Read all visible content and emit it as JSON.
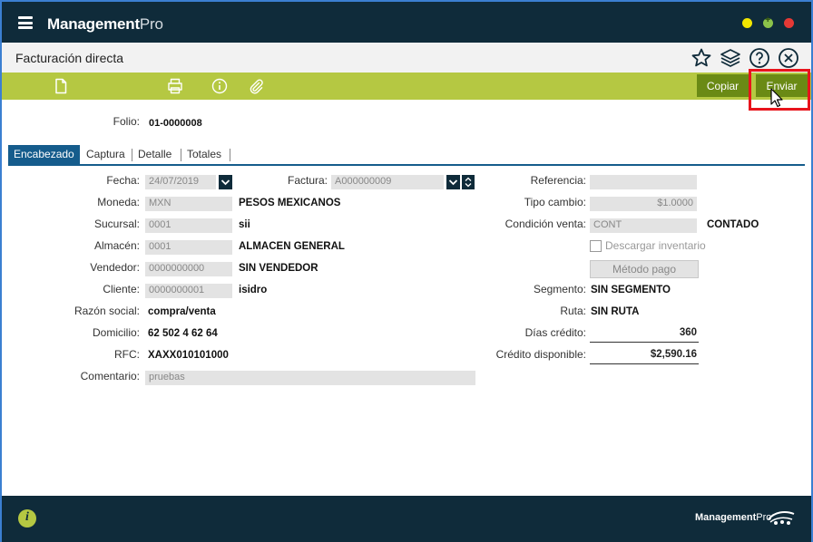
{
  "app": {
    "title_main": "Management",
    "title_suffix": "Pro"
  },
  "header": {
    "title": "Facturación directa"
  },
  "toolbar": {
    "copy_label": "Copiar",
    "send_label": "Enviar"
  },
  "folio": {
    "label": "Folio:",
    "value": "01-0000008"
  },
  "tabs": [
    {
      "label": "Encabezado",
      "active": true
    },
    {
      "label": "Captura",
      "active": false
    },
    {
      "label": "Detalle",
      "active": false
    },
    {
      "label": "Totales",
      "active": false
    }
  ],
  "form": {
    "fecha": {
      "label": "Fecha:",
      "value": "24/07/2019"
    },
    "factura": {
      "label": "Factura:",
      "value": "A000000009"
    },
    "moneda": {
      "label": "Moneda:",
      "code": "MXN",
      "name": "PESOS MEXICANOS"
    },
    "sucursal": {
      "label": "Sucursal:",
      "code": "0001",
      "name": "sii"
    },
    "almacen": {
      "label": "Almacén:",
      "code": "0001",
      "name": "ALMACEN GENERAL"
    },
    "vendedor": {
      "label": "Vendedor:",
      "code": "0000000000",
      "name": "SIN VENDEDOR"
    },
    "cliente": {
      "label": "Cliente:",
      "code": "0000000001",
      "name": "isidro"
    },
    "razon_social": {
      "label": "Razón social:",
      "value": "compra/venta"
    },
    "domicilio": {
      "label": "Domicilio:",
      "value": "62 502 4 62 64"
    },
    "rfc": {
      "label": "RFC:",
      "value": "XAXX010101000"
    },
    "comentario": {
      "label": "Comentario:",
      "value": "pruebas"
    },
    "referencia": {
      "label": "Referencia:",
      "value": ""
    },
    "tipo_cambio": {
      "label": "Tipo cambio:",
      "value": "$1.0000"
    },
    "condicion_venta": {
      "label": "Condición venta:",
      "code": "CONT",
      "name": "CONTADO"
    },
    "descargar": {
      "label": "Descargar inventario",
      "checked": false
    },
    "metodo_pago": {
      "label": "Método pago"
    },
    "segmento": {
      "label": "Segmento:",
      "value": "SIN SEGMENTO"
    },
    "ruta": {
      "label": "Ruta:",
      "value": "SIN RUTA"
    },
    "dias_credito": {
      "label": "Días crédito:",
      "value": "360"
    },
    "credito_disponible": {
      "label": "Crédito disponible:",
      "value": "$2,590.16"
    }
  },
  "footer": {
    "brand_main": "Management",
    "brand_suffix": "Pro"
  },
  "colors": {
    "titlebar": "#0f2b3a",
    "toolbar": "#b5c842",
    "button": "#6a8a15",
    "tab_active": "#155c8c",
    "highlight": "#e8141c"
  },
  "icons": [
    "hamburger-icon",
    "star-icon",
    "layers-icon",
    "help-icon",
    "close-circle-icon",
    "new-document-icon",
    "print-icon",
    "info-icon",
    "attach-icon",
    "cursor-icon",
    "footer-info-icon",
    "footer-logo-icon"
  ]
}
